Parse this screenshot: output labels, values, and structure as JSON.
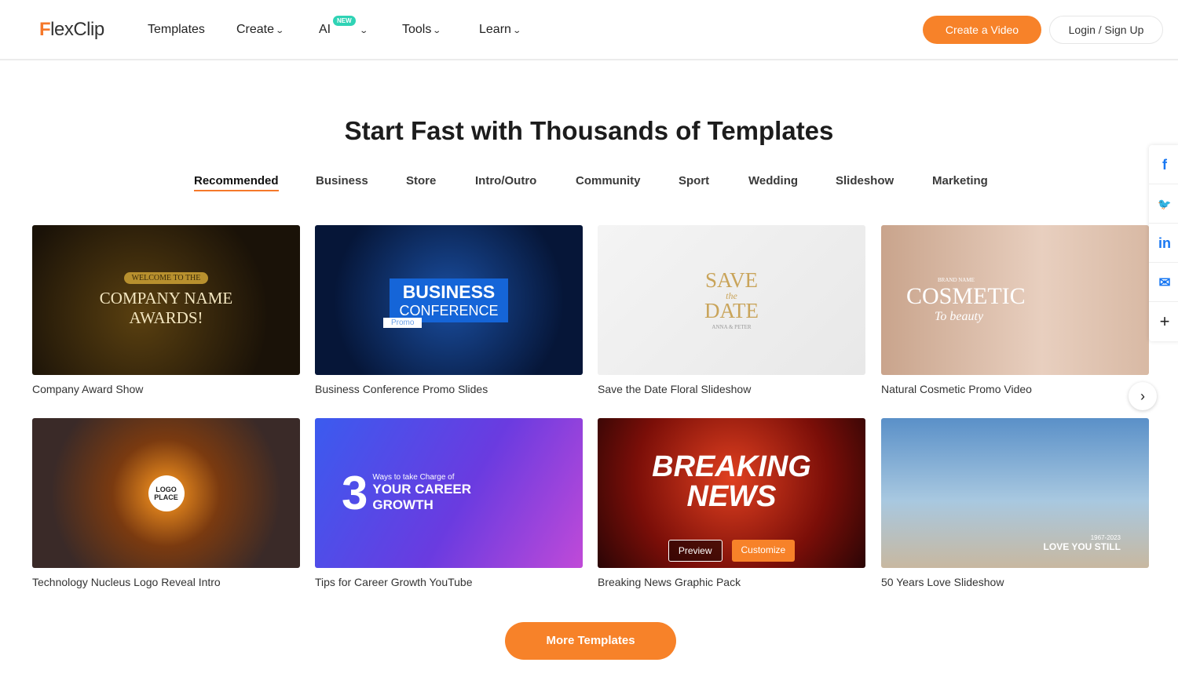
{
  "header": {
    "logo": {
      "first": "F",
      "rest": "lexClip"
    },
    "nav": [
      {
        "label": "Templates"
      },
      {
        "label": "Create"
      },
      {
        "label": "AI",
        "badge": "NEW"
      },
      {
        "label": "Tools"
      },
      {
        "label": "Learn"
      }
    ],
    "create_label": "Create a Video",
    "login_label": "Login / Sign Up"
  },
  "main": {
    "title": "Start Fast with Thousands of Templates",
    "tabs": [
      "Recommended",
      "Business",
      "Store",
      "Intro/Outro",
      "Community",
      "Sport",
      "Wedding",
      "Slideshow",
      "Marketing"
    ],
    "templates": [
      {
        "title": "Company Award Show",
        "thumb_text": [
          "WELCOME TO THE",
          "COMPANY NAME",
          "AWARDS!"
        ]
      },
      {
        "title": "Business Conference Promo Slides",
        "thumb_text": [
          "BUSINESS",
          "CONFERENCE",
          "Promo"
        ]
      },
      {
        "title": "Save the Date Floral Slideshow",
        "thumb_text": [
          "SAVE",
          "the",
          "DATE",
          "ANNA & PETER"
        ]
      },
      {
        "title": "Natural Cosmetic Promo Video",
        "thumb_text": [
          "BRAND NAME",
          "COSMETIC",
          "To beauty"
        ]
      },
      {
        "title": "Technology Nucleus Logo Reveal Intro",
        "thumb_text": [
          "LOGO",
          "PLACE"
        ]
      },
      {
        "title": "Tips for Career Growth YouTube",
        "thumb_text": [
          "3",
          "Ways to take Charge of",
          "YOUR CAREER",
          "GROWTH"
        ]
      },
      {
        "title": "Breaking News Graphic Pack",
        "thumb_text": [
          "BREAKING",
          "NEWS"
        ],
        "preview_label": "Preview",
        "customize_label": "Customize"
      },
      {
        "title": "50 Years Love Slideshow",
        "thumb_text": [
          "1967-2023",
          "LOVE YOU STILL"
        ]
      }
    ],
    "more_label": "More Templates"
  },
  "share": [
    {
      "icon": "facebook-icon",
      "glyph": "f"
    },
    {
      "icon": "twitter-icon",
      "glyph": "🐦"
    },
    {
      "icon": "linkedin-icon",
      "glyph": "in"
    },
    {
      "icon": "email-icon",
      "glyph": "✉"
    },
    {
      "icon": "plus-icon",
      "glyph": "+"
    }
  ],
  "colors": {
    "accent": "#f78229",
    "new_badge": "#2fd3b5"
  }
}
